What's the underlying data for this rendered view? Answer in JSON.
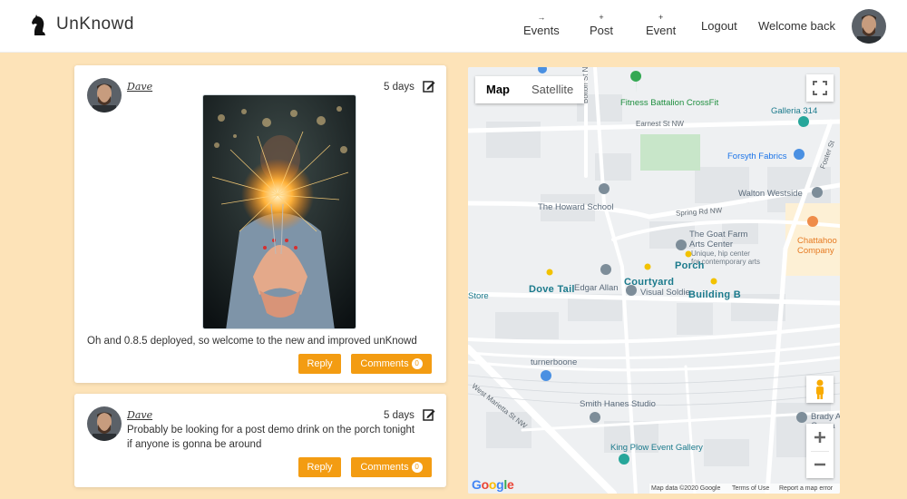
{
  "header": {
    "brand": "UnKnowd",
    "nav": [
      {
        "glyph": "→",
        "label": "Events"
      },
      {
        "glyph": "+",
        "label": "Post"
      },
      {
        "glyph": "+",
        "label": "Event"
      }
    ],
    "logout": "Logout",
    "welcome": "Welcome back"
  },
  "posts": [
    {
      "author": "Dave",
      "age": "5 days",
      "text": "Oh and 0.8.5 deployed, so welcome to the new and improved unKnowd",
      "reply_label": "Reply",
      "comments_label": "Comments",
      "comments_count": "0"
    },
    {
      "author": "Dave",
      "age": "5 days",
      "text_line1": "Probably be looking for a post demo drink on the porch tonight",
      "text_line2": "if anyone is gonna be around",
      "reply_label": "Reply",
      "comments_label": "Comments",
      "comments_count": "0"
    }
  ],
  "map": {
    "map_button": "Map",
    "satellite_button": "Satellite",
    "places": {
      "fitness": "Fitness Battalion CrossFit",
      "galleria": "Galleria 314",
      "earnest": "Earnest St NW",
      "forsyth": "Forsyth Fabrics",
      "foster": "Foster St",
      "walton": "Walton Westside",
      "howard": "The Howard School",
      "spring": "Spring Rd NW",
      "goatfarm1": "The Goat Farm",
      "goatfarm2": "Arts Center",
      "goatdesc1": "Unique, hip center",
      "goatdesc2": "for contemporary arts",
      "chatta1": "Chattahoo",
      "chatta2": "Company",
      "porch": "Porch",
      "courtyard": "Courtyard",
      "dovetail": "Dove Tail",
      "edgar": "Edgar Allan",
      "visual": "Visual Soldie",
      "buildingb": "Building B",
      "store": "Store",
      "turnerboone": "turnerboone",
      "westmarietta": "West Marietta St NW",
      "smithhanes": "Smith Hanes Studio",
      "kingplow": "King Plow Event Gallery",
      "brady1": "Brady A",
      "brady2": "Opera",
      "bolton": "Bolton St NW"
    },
    "google": "Google",
    "footer_data": "Map data ©2020 Google",
    "footer_terms": "Terms of Use",
    "footer_report": "Report a map error"
  }
}
